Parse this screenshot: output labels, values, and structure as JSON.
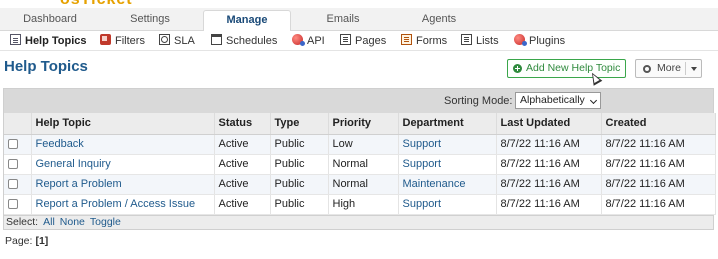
{
  "logo": {
    "text_a": "osTicket",
    "text_b": ""
  },
  "main_nav": [
    {
      "label": "Dashboard"
    },
    {
      "label": "Settings"
    },
    {
      "label": "Manage"
    },
    {
      "label": "Emails"
    },
    {
      "label": "Agents"
    }
  ],
  "sub_nav": [
    {
      "label": "Help Topics",
      "icon": "document-icon"
    },
    {
      "label": "Filters",
      "icon": "filter-icon"
    },
    {
      "label": "SLA",
      "icon": "sla-icon"
    },
    {
      "label": "Schedules",
      "icon": "calendar-icon"
    },
    {
      "label": "API",
      "icon": "api-icon"
    },
    {
      "label": "Pages",
      "icon": "pages-icon"
    },
    {
      "label": "Forms",
      "icon": "forms-icon"
    },
    {
      "label": "Lists",
      "icon": "lists-icon"
    },
    {
      "label": "Plugins",
      "icon": "plugins-icon"
    }
  ],
  "page": {
    "title": "Help Topics",
    "add_button": "Add New Help Topic",
    "more_button": "More"
  },
  "sorting": {
    "label": "Sorting Mode:",
    "selected": "Alphabetically"
  },
  "table": {
    "columns": [
      "Help Topic",
      "Status",
      "Type",
      "Priority",
      "Department",
      "Last Updated",
      "Created"
    ],
    "rows": [
      {
        "topic": "Feedback",
        "status": "Active",
        "type": "Public",
        "priority": "Low",
        "department": "Support",
        "updated": "8/7/22 11:16 AM",
        "created": "8/7/22 11:16 AM"
      },
      {
        "topic": "General Inquiry",
        "status": "Active",
        "type": "Public",
        "priority": "Normal",
        "department": "Support",
        "updated": "8/7/22 11:16 AM",
        "created": "8/7/22 11:16 AM"
      },
      {
        "topic": "Report a Problem",
        "status": "Active",
        "type": "Public",
        "priority": "Normal",
        "department": "Maintenance",
        "updated": "8/7/22 11:16 AM",
        "created": "8/7/22 11:16 AM"
      },
      {
        "topic": "Report a Problem / Access Issue",
        "status": "Active",
        "type": "Public",
        "priority": "High",
        "department": "Support",
        "updated": "8/7/22 11:16 AM",
        "created": "8/7/22 11:16 AM"
      }
    ]
  },
  "footer": {
    "select_label": "Select:",
    "all": "All",
    "none": "None",
    "toggle": "Toggle"
  },
  "pagination": {
    "label": "Page:",
    "current": "[1]"
  }
}
